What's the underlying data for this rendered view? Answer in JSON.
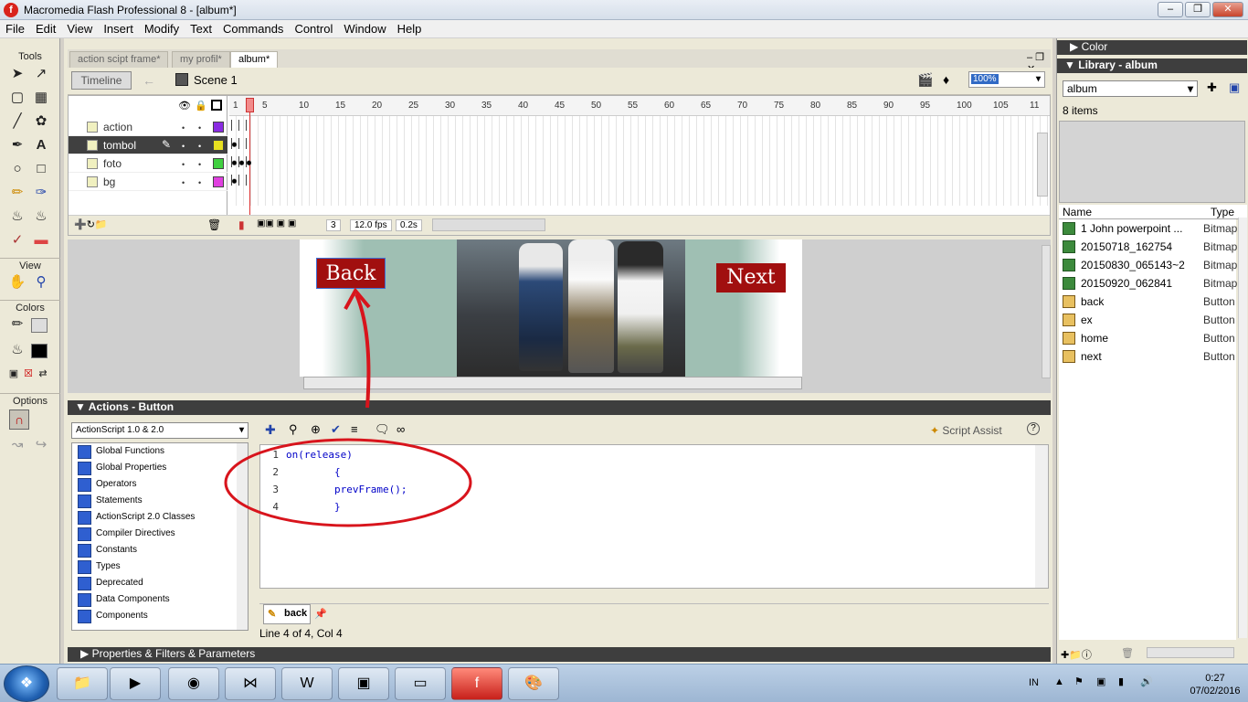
{
  "window": {
    "title": "Macromedia Flash Professional 8 - [album*]",
    "app_icon": "flash-icon"
  },
  "menu": [
    "File",
    "Edit",
    "View",
    "Insert",
    "Modify",
    "Text",
    "Commands",
    "Control",
    "Window",
    "Help"
  ],
  "tools": {
    "section_tools": "Tools",
    "section_view": "View",
    "section_colors": "Colors",
    "section_options": "Options"
  },
  "doc_tabs": [
    "action scipt frame*",
    "my profil*",
    "album*"
  ],
  "timeline": {
    "button": "Timeline",
    "scene": "Scene 1",
    "zoom": "100%",
    "layers": [
      {
        "name": "action",
        "color": "#8a2be2"
      },
      {
        "name": "tombol",
        "color": "#e8e020"
      },
      {
        "name": "foto",
        "color": "#40d040"
      },
      {
        "name": "bg",
        "color": "#e040e0"
      }
    ],
    "frame_numbers": [
      "1",
      "5",
      "10",
      "15",
      "20",
      "25",
      "30",
      "35",
      "40",
      "45",
      "50",
      "55",
      "60",
      "65",
      "70",
      "75",
      "80",
      "85",
      "90",
      "95",
      "100",
      "105",
      "11"
    ],
    "current_frame": "3",
    "fps": "12.0 fps",
    "time": "0.2s"
  },
  "stage": {
    "back_label": "Back",
    "next_label": "Next"
  },
  "actions": {
    "header": "Actions - Button",
    "version": "ActionScript 1.0 & 2.0",
    "toolbox": [
      "Global Functions",
      "Global Properties",
      "Operators",
      "Statements",
      "ActionScript 2.0 Classes",
      "Compiler Directives",
      "Constants",
      "Types",
      "Deprecated",
      "Data Components",
      "Components"
    ],
    "script_assist": "Script Assist",
    "code_lines": [
      {
        "num": "1",
        "text": "on(release)"
      },
      {
        "num": "2",
        "text": "        {"
      },
      {
        "num": "3",
        "text": "        prevFrame();"
      },
      {
        "num": "4",
        "text": "        }"
      }
    ],
    "script_tab": "back",
    "status": "Line 4 of 4, Col 4"
  },
  "properties_bar": "Properties & Filters & Parameters",
  "color_panel": "Color",
  "library": {
    "header": "Library - album",
    "selected": "album",
    "count": "8 items",
    "col_name": "Name",
    "col_type": "Type",
    "items": [
      {
        "name": "1 John powerpoint ...",
        "type": "Bitmap",
        "kind": "bitmap"
      },
      {
        "name": "20150718_162754",
        "type": "Bitmap",
        "kind": "bitmap"
      },
      {
        "name": "20150830_065143~2",
        "type": "Bitmap",
        "kind": "bitmap"
      },
      {
        "name": "20150920_062841",
        "type": "Bitmap",
        "kind": "bitmap"
      },
      {
        "name": "back",
        "type": "Button",
        "kind": "button"
      },
      {
        "name": "ex",
        "type": "Button",
        "kind": "button"
      },
      {
        "name": "home",
        "type": "Button",
        "kind": "button"
      },
      {
        "name": "next",
        "type": "Button",
        "kind": "button"
      }
    ]
  },
  "taskbar": {
    "language": "IN",
    "time": "0:27",
    "date": "07/02/2016"
  },
  "annotation_color": "#d8141c"
}
